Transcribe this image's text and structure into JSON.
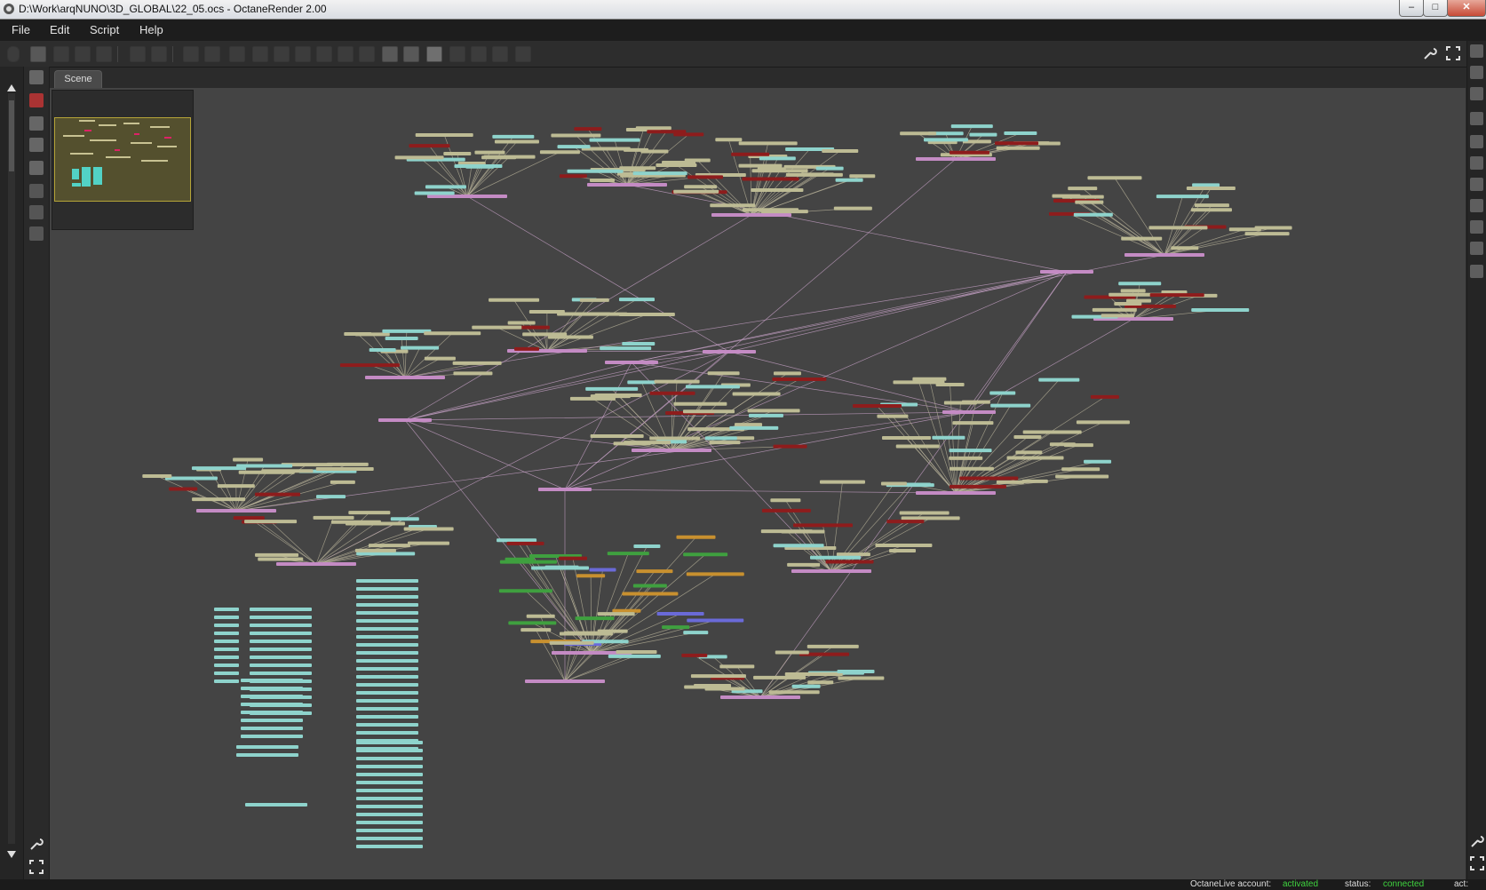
{
  "window": {
    "title": "D:\\Work\\arqNUNO\\3D_GLOBAL\\22_05.ocs - OctaneRender 2.00",
    "minimize": "–",
    "maximize": "□",
    "close": "✕"
  },
  "menu": {
    "items": [
      "File",
      "Edit",
      "Script",
      "Help"
    ]
  },
  "toolbar": {
    "icons": [
      "save-icon",
      "render-region-icon",
      "focus-picker-icon",
      "material-picker-icon",
      "stop-icon",
      "restart-icon",
      "pause-icon",
      "start-icon",
      "display-icon",
      "camera-icon",
      "clay-mode-icon",
      "subsample-icon",
      "lock-icon",
      "preview-icon",
      "region-icon",
      "film-region-icon",
      "real-time-icon",
      "copy-icon",
      "paste-icon",
      "settings-icon",
      "pin-icon"
    ],
    "right_icons": [
      "wrench-icon",
      "fullscreen-icon"
    ]
  },
  "node_editor": {
    "tab_label": "Scene",
    "colors": {
      "background": "#444444",
      "node_default": "#bdbb94",
      "node_texture": "#8ed3cc",
      "node_geometry": "#c48bc4",
      "node_material_red": "#8e1c1c",
      "node_green": "#3fa03f",
      "node_orange": "#c8902f",
      "node_blue": "#6a6ad8",
      "wire": "#b9b39a",
      "wire_pink": "#c9a3c9"
    }
  },
  "status": {
    "account_label": "OctaneLive account:",
    "account_value": "activated",
    "status_label": "status:",
    "status_value": "connected",
    "act_label": "act:"
  }
}
